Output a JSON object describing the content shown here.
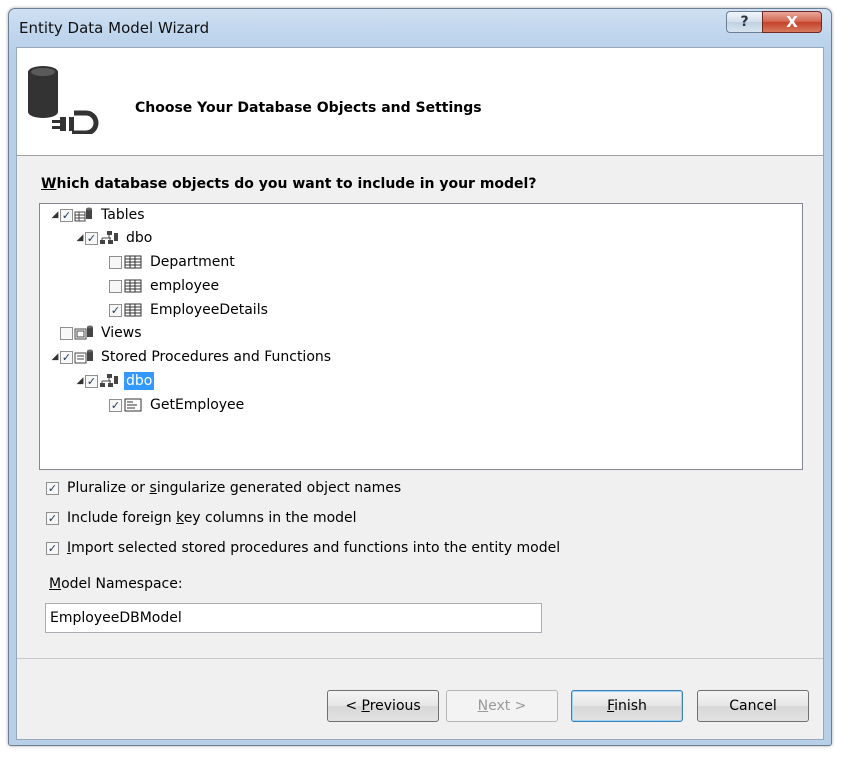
{
  "window": {
    "title": "Entity Data Model Wizard",
    "help_label": "?",
    "close_label": "X"
  },
  "header": {
    "title": "Choose Your Database Objects and Settings"
  },
  "question": {
    "accel": "W",
    "rest": "hich database objects do you want to include in your model?"
  },
  "tree": [
    {
      "label": "Tables",
      "checked": true,
      "expanded": true,
      "icon": "tables-icon"
    },
    {
      "label": "dbo",
      "checked": true,
      "expanded": true,
      "icon": "schema-icon"
    },
    {
      "label": "Department",
      "checked": false,
      "icon": "table-icon"
    },
    {
      "label": "employee",
      "checked": false,
      "icon": "table-icon"
    },
    {
      "label": "EmployeeDetails",
      "checked": true,
      "icon": "table-icon"
    },
    {
      "label": "Views",
      "checked": false,
      "icon": "views-icon"
    },
    {
      "label": "Stored Procedures and Functions",
      "checked": true,
      "expanded": true,
      "icon": "procedures-icon"
    },
    {
      "label": "dbo",
      "checked": true,
      "expanded": true,
      "selected": true,
      "icon": "schema-icon"
    },
    {
      "label": "GetEmployee",
      "checked": true,
      "icon": "procedure-icon"
    }
  ],
  "options": {
    "pluralize": {
      "pre": "Pluralize or ",
      "accel": "s",
      "post": "ingularize generated object names",
      "checked": true
    },
    "foreign_keys": {
      "pre": "Include foreign ",
      "accel": "k",
      "post": "ey columns in the model",
      "checked": true
    },
    "import_procs": {
      "pre": "",
      "accel": "I",
      "post": "mport selected stored procedures and functions into the entity model",
      "checked": true
    }
  },
  "namespace": {
    "label_accel": "M",
    "label_rest": "odel Namespace:",
    "value": "EmployeeDBModel"
  },
  "buttons": {
    "previous": {
      "pre": "< ",
      "accel": "P",
      "post": "revious"
    },
    "next": {
      "pre": "",
      "accel": "N",
      "post": "ext >"
    },
    "finish": {
      "pre": "",
      "accel": "F",
      "post": "inish"
    },
    "cancel": "Cancel"
  }
}
